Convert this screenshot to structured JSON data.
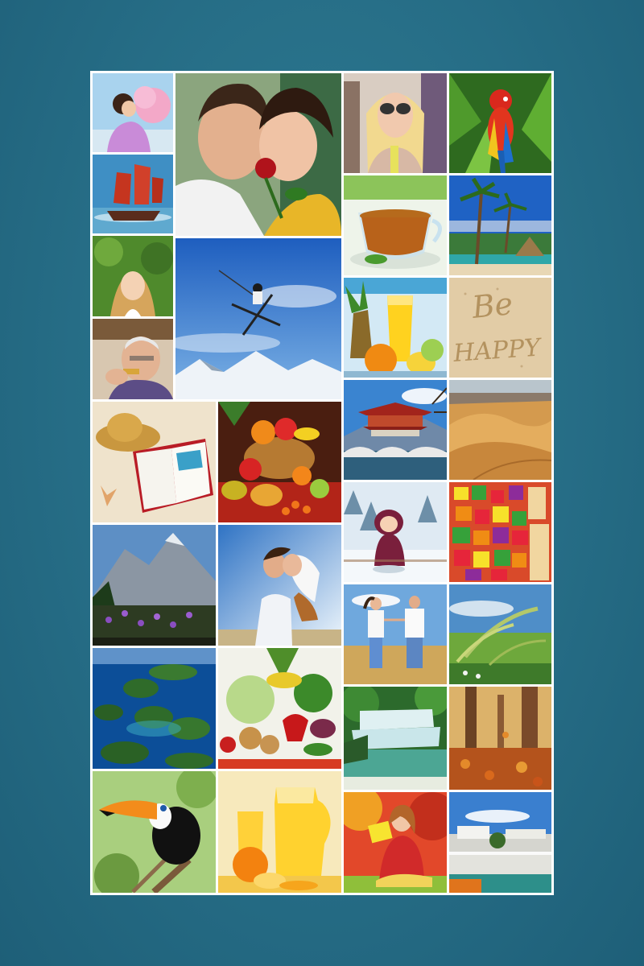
{
  "background_color": "#276f88",
  "frame_color": "#ffffff",
  "sand_writing": {
    "line1": "Be",
    "line2": "HAPPY"
  },
  "photos": [
    {
      "name": "girl-with-cotton-candy-photo"
    },
    {
      "name": "couple-with-rose-photo"
    },
    {
      "name": "woman-with-sunglasses-photo"
    },
    {
      "name": "macaw-parrot-photo"
    },
    {
      "name": "red-sailed-ship-photo"
    },
    {
      "name": "cup-of-tea-photo"
    },
    {
      "name": "tropical-beach-palms-photo"
    },
    {
      "name": "girl-in-grass-photo"
    },
    {
      "name": "skier-jump-photo"
    },
    {
      "name": "orange-juice-fruits-photo"
    },
    {
      "name": "be-happy-sand-photo"
    },
    {
      "name": "man-with-harmonica-photo"
    },
    {
      "name": "straw-hat-book-photo"
    },
    {
      "name": "fruit-basket-photo"
    },
    {
      "name": "chinese-pagoda-bridge-photo"
    },
    {
      "name": "desert-dunes-photo"
    },
    {
      "name": "cartoon-girl-snow-photo"
    },
    {
      "name": "colorful-candies-photo"
    },
    {
      "name": "mountain-flowers-photo"
    },
    {
      "name": "embracing-couple-photo"
    },
    {
      "name": "couple-running-field-photo"
    },
    {
      "name": "wheat-ears-photo"
    },
    {
      "name": "tropical-islands-photo"
    },
    {
      "name": "vegetables-photo"
    },
    {
      "name": "waterfall-photo"
    },
    {
      "name": "autumn-forest-photo"
    },
    {
      "name": "toucan-photo"
    },
    {
      "name": "juice-jug-photo"
    },
    {
      "name": "woman-reading-autumn-photo"
    },
    {
      "name": "pier-buildings-photo"
    }
  ]
}
